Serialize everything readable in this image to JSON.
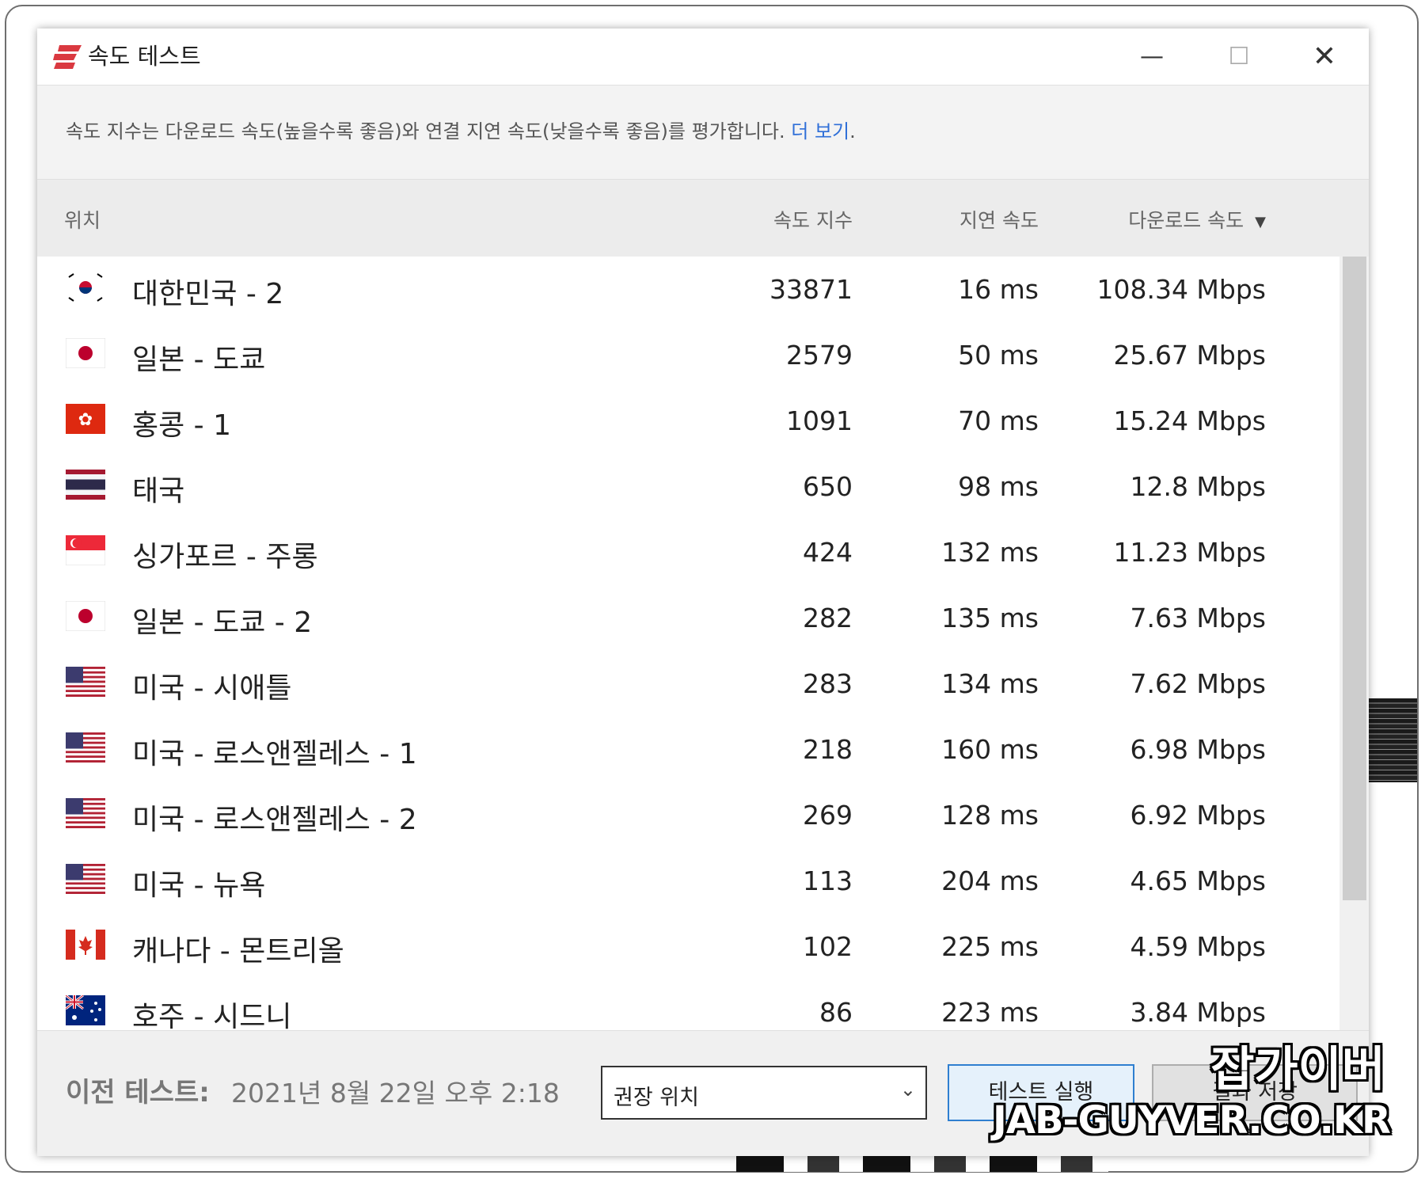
{
  "window": {
    "title": "속도 테스트",
    "description": "속도 지수는 다운로드 속도(높을수록 좋음)와 연결 지연 속도(낮을수록 좋음)를 평가합니다.",
    "description_link": "더 보기",
    "description_tail": ".",
    "controls": {
      "minimize": "—",
      "maximize": "☐",
      "close": "✕"
    }
  },
  "columns": {
    "location": "위치",
    "score": "속도 지수",
    "latency": "지연 속도",
    "download": "다운로드 속도",
    "sort_icon": "▼"
  },
  "rows": [
    {
      "location": "대한민국 - 2",
      "score": "33871",
      "latency": "16 ms",
      "download": "108.34 Mbps",
      "flag": "kr"
    },
    {
      "location": "일본 - 도쿄",
      "score": "2579",
      "latency": "50 ms",
      "download": "25.67 Mbps",
      "flag": "jp"
    },
    {
      "location": "홍콩 - 1",
      "score": "1091",
      "latency": "70 ms",
      "download": "15.24 Mbps",
      "flag": "hk"
    },
    {
      "location": "태국",
      "score": "650",
      "latency": "98 ms",
      "download": "12.8 Mbps",
      "flag": "th"
    },
    {
      "location": "싱가포르 - 주롱",
      "score": "424",
      "latency": "132 ms",
      "download": "11.23 Mbps",
      "flag": "sg"
    },
    {
      "location": "일본 - 도쿄 - 2",
      "score": "282",
      "latency": "135 ms",
      "download": "7.63 Mbps",
      "flag": "jp"
    },
    {
      "location": "미국 - 시애틀",
      "score": "283",
      "latency": "134 ms",
      "download": "7.62 Mbps",
      "flag": "us"
    },
    {
      "location": "미국 - 로스앤젤레스 - 1",
      "score": "218",
      "latency": "160 ms",
      "download": "6.98 Mbps",
      "flag": "us"
    },
    {
      "location": "미국 - 로스앤젤레스 - 2",
      "score": "269",
      "latency": "128 ms",
      "download": "6.92 Mbps",
      "flag": "us"
    },
    {
      "location": "미국 - 뉴욕",
      "score": "113",
      "latency": "204 ms",
      "download": "4.65 Mbps",
      "flag": "us"
    },
    {
      "location": "캐나다 - 몬트리올",
      "score": "102",
      "latency": "225 ms",
      "download": "4.59 Mbps",
      "flag": "ca"
    },
    {
      "location": "호주 - 시드니",
      "score": "86",
      "latency": "223 ms",
      "download": "3.84 Mbps",
      "flag": "au"
    }
  ],
  "footer": {
    "previous_label": "이전 테스트:",
    "previous_value": "2021년 8월 22일 오후 2:18",
    "select_value": "권장 위치",
    "run_button": "테스트 실행",
    "save_button": "결과 저장"
  },
  "watermark": {
    "line1": "잡가이버",
    "line2": "JAB-GUYVER.CO.KR"
  },
  "colors": {
    "accent": "#da3940",
    "link": "#2f6fd8",
    "header_bg": "#ececec",
    "footer_bg": "#f0f0f0"
  }
}
